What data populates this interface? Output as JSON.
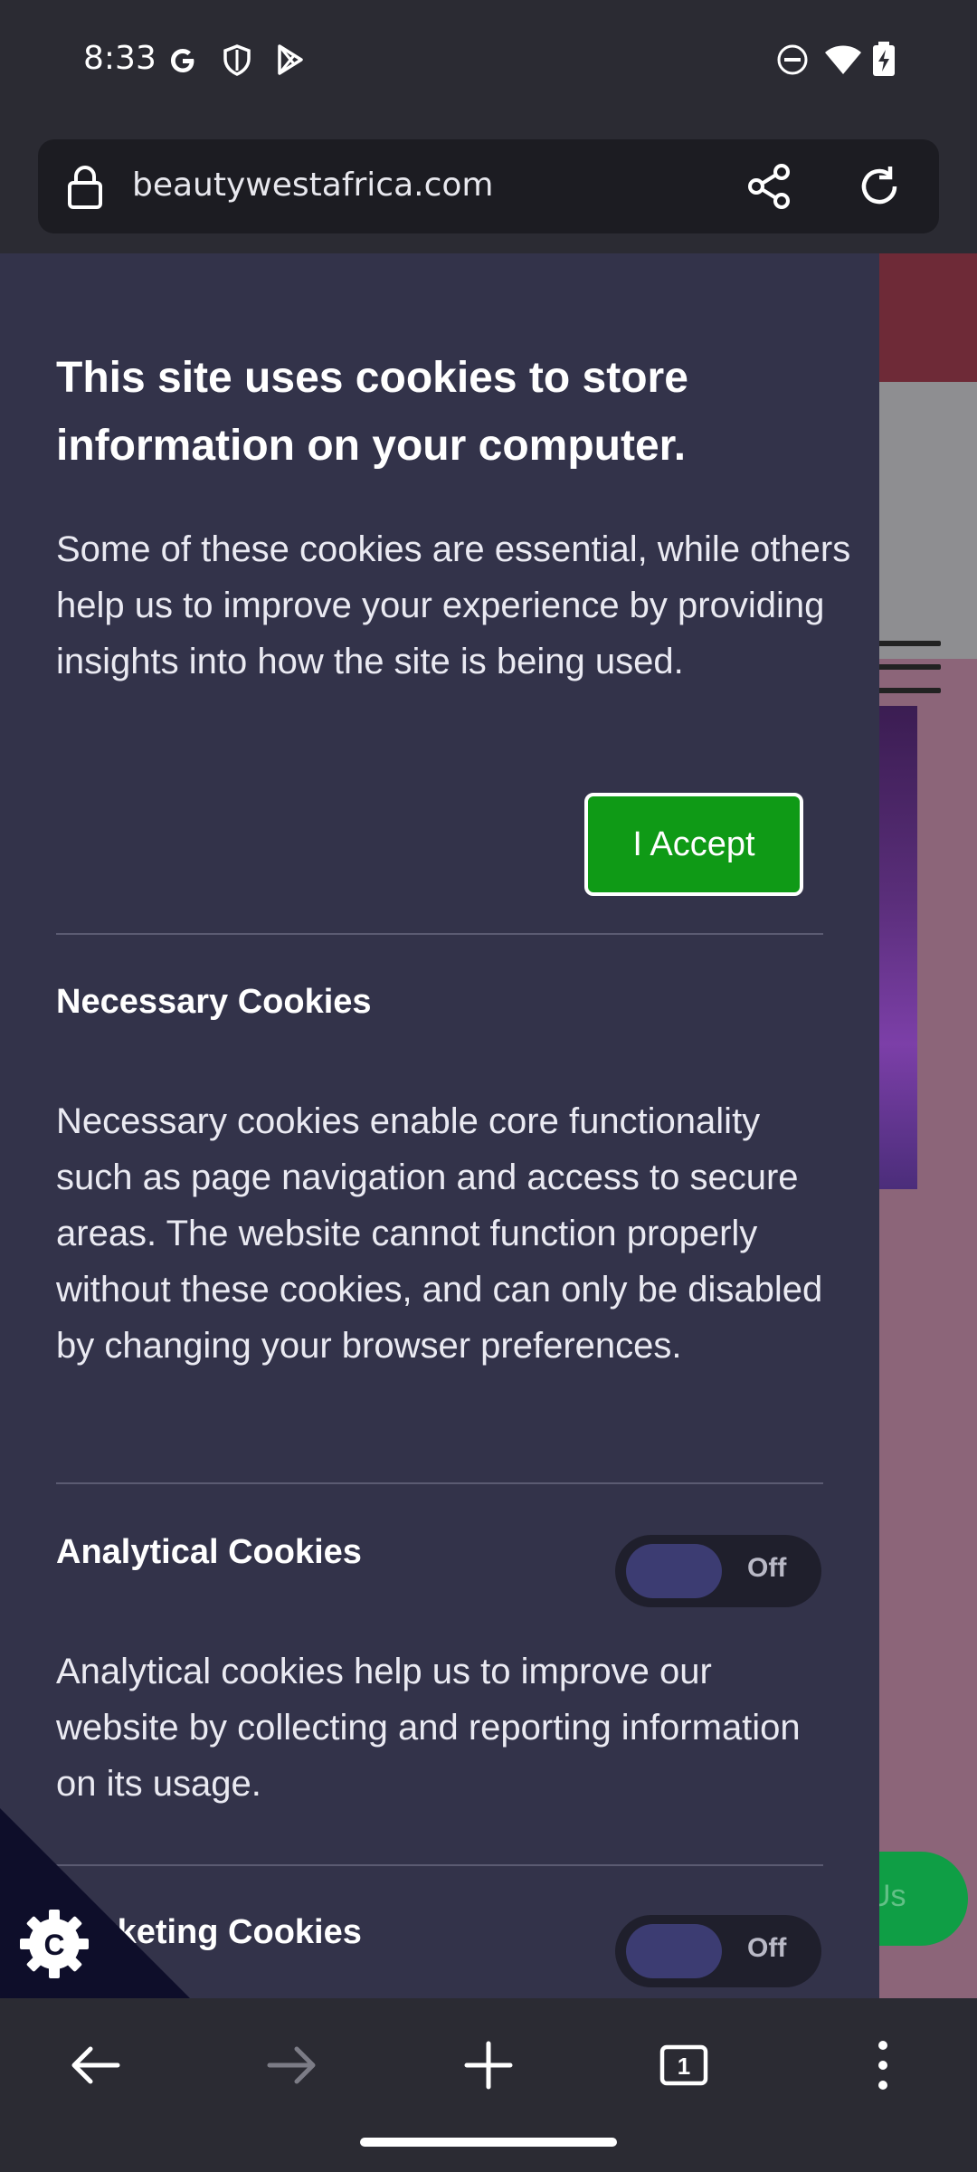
{
  "status_bar": {
    "time": "8:33",
    "icons": [
      "google-icon",
      "shield-icon",
      "play-store-icon",
      "do-not-disturb-icon",
      "wifi-icon",
      "battery-charging-icon"
    ]
  },
  "browser": {
    "url": "beautywestafrica.com",
    "icons": [
      "lock-icon",
      "share-icon",
      "reload-icon"
    ]
  },
  "background_page": {
    "chat_button_text": "Us"
  },
  "cookie_panel": {
    "title": "This site uses cookies to store information on your computer.",
    "intro": "Some of these cookies are essential, while others help us to improve your experience by providing insights into how the site is being used.",
    "accept_label": "I Accept",
    "sections": [
      {
        "title": "Necessary Cookies",
        "text": "Necessary cookies enable core functionality such as page navigation and access to secure areas. The website cannot function properly without these cookies, and can only be disabled by changing your browser preferences."
      },
      {
        "title": "Analytical Cookies",
        "toggle": "Off",
        "text": "Analytical cookies help us to improve our website by collecting and reporting information on its usage."
      },
      {
        "title": "Marketing Cookies",
        "toggle": "Off"
      }
    ],
    "colors": {
      "panel_bg": "#33334a",
      "accept_bg": "#0f9a16",
      "toggle_knob": "#3c3c72"
    }
  },
  "cookie_fab": {
    "letter": "C"
  },
  "bottom_nav": {
    "icons": [
      "back-icon",
      "forward-icon",
      "new-tab-icon",
      "tabs-icon",
      "more-icon"
    ],
    "tab_count": "1"
  }
}
